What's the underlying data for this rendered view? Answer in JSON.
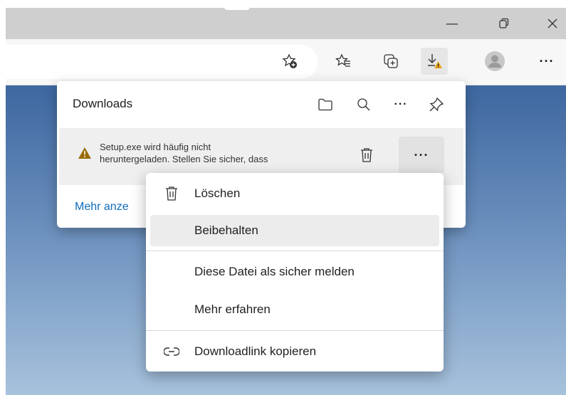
{
  "window": {
    "minimize_label": "—",
    "restore_label": "⧉",
    "close_label": "✕"
  },
  "toolbar": {
    "icons": [
      "favorite-add-icon",
      "favorites-icon",
      "collections-icon",
      "downloads-warning-icon",
      "profile-avatar-icon",
      "more-options-icon"
    ],
    "more_label": "···"
  },
  "downloads": {
    "title": "Downloads",
    "header_icons": [
      "folder-icon",
      "search-icon",
      "more-icon",
      "pin-icon"
    ],
    "header_more_label": "···",
    "item": {
      "line1": "Setup.exe wird häufig nicht",
      "line2": "heruntergeladen. Stellen Sie sicher, dass",
      "more_label": "···"
    },
    "show_more": "Mehr anze"
  },
  "context_menu": {
    "items": [
      {
        "label": "Löschen",
        "icon": "trash-icon"
      },
      {
        "label": "Beibehalten",
        "icon": ""
      },
      {
        "label": "Diese Datei als sicher melden",
        "icon": ""
      },
      {
        "label": "Mehr erfahren",
        "icon": ""
      },
      {
        "label": "Downloadlink kopieren",
        "icon": "link-icon"
      }
    ]
  },
  "colors": {
    "accent_link": "#0f6cbd",
    "warning": "#c49a00",
    "hover": "#ececec"
  }
}
